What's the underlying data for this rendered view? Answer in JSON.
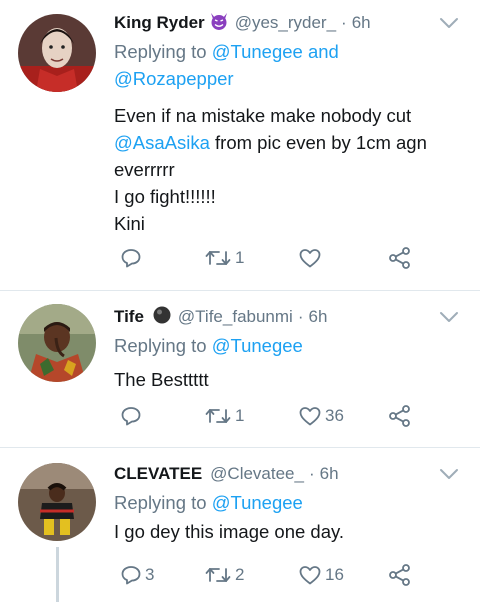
{
  "tweets": [
    {
      "name": "King Ryder",
      "badge": "smiling-devil-emoji",
      "handle": "@yes_ryder_",
      "dot": "·",
      "time": "6h",
      "replying_label": "Replying to",
      "replying_to": [
        "@Tunegee",
        "@Rozapepper"
      ],
      "replying_and": "and",
      "body_line1": "Even if na mistake make nobody cut",
      "body_mention": "@AsaAsika",
      "body_line2_rest": " from pic even by 1cm agn",
      "body_line3": "everrrrr",
      "body_line4": "I go fight!!!!!!",
      "body_line5": "Kini",
      "stats": {
        "replies": "",
        "retweets": "1",
        "likes": ""
      }
    },
    {
      "name": "Tife",
      "badge": "black-circle-emoji",
      "handle": "@Tife_fabunmi",
      "dot": "·",
      "time": "6h",
      "replying_label": "Replying to",
      "replying_to": [
        "@Tunegee"
      ],
      "body_line1": "The Besttttt",
      "stats": {
        "replies": "",
        "retweets": "1",
        "likes": "36"
      }
    },
    {
      "name": "CLEVATEE",
      "handle": "@Clevatee_",
      "dot": "·",
      "time": "6h",
      "replying_label": "Replying to",
      "replying_to": [
        "@Tunegee"
      ],
      "body_line1": "I go dey this image one day.",
      "stats": {
        "replies": "3",
        "retweets": "2",
        "likes": "16"
      }
    }
  ],
  "colors": {
    "link": "#1da1f2",
    "secondary_text": "#657786",
    "primary_text": "#14171a",
    "divider": "#e1e8ed",
    "icon": "#657786"
  },
  "icons": [
    "reply-icon",
    "retweet-icon",
    "like-icon",
    "share-icon",
    "chevron-down-icon"
  ]
}
